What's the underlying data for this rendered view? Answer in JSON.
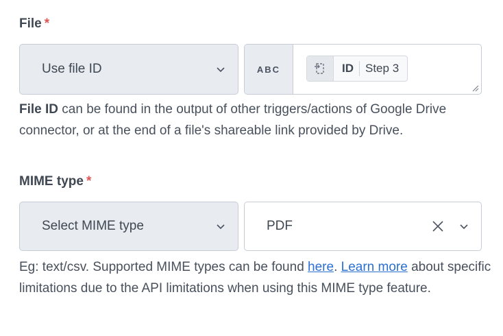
{
  "file_section": {
    "label": "File",
    "required_mark": "*",
    "source_select": {
      "value": "Use file ID"
    },
    "type_badge": "ABC",
    "datapill": {
      "field": "ID",
      "step": "Step 3"
    },
    "help_bold": "File ID",
    "help_rest": " can be found in the output of other triggers/actions of Google Drive connector, or at the end of a file's shareable link provided by Drive."
  },
  "mime_section": {
    "label": "MIME type",
    "required_mark": "*",
    "source_select": {
      "value": "Select MIME type"
    },
    "value_select": {
      "value": "PDF"
    },
    "help_prefix": "Eg: text/csv. Supported MIME types can be found ",
    "link_here": "here",
    "help_mid": ". ",
    "link_learn_more": "Learn more",
    "help_suffix": " about specific limitations due to the API limitations when using this MIME type feature."
  },
  "icons": {
    "dropdown": "chevron-down-icon",
    "datapill": "step-output-icon",
    "clear": "close-icon",
    "resize": "resize-handle-icon"
  },
  "colors": {
    "required": "#e05555",
    "link": "#2b6fd1",
    "field_bg": "#e8ebf0",
    "border": "#c7ccd4"
  }
}
